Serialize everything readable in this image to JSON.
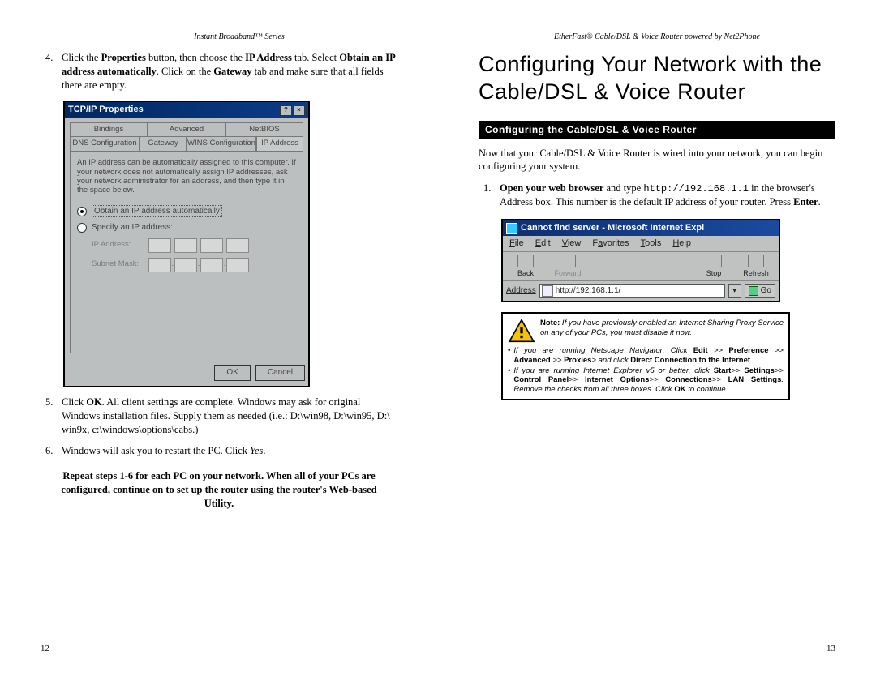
{
  "left": {
    "header": "Instant Broadband™ Series",
    "page_num": "12",
    "step4_a": "Click the ",
    "step4_b": "Properties",
    "step4_c": " button, then choose the ",
    "step4_d": "IP Address",
    "step4_e": " tab. Select ",
    "step4_f": "Obtain an IP address automatically",
    "step4_g": ". Click on the ",
    "step4_h": "Gateway",
    "step4_i": " tab and make sure that all fields there are empty.",
    "dlg": {
      "title": "TCP/IP Properties",
      "tabs_row1": [
        "Bindings",
        "Advanced",
        "NetBIOS"
      ],
      "tabs_row2": [
        "DNS Configuration",
        "Gateway",
        "WINS Configuration",
        "IP Address"
      ],
      "help": "An IP address can be automatically assigned to this computer. If your network does not automatically assign IP addresses, ask your network administrator for an address, and then type it in the space below.",
      "radio_obtain": "Obtain an IP address automatically",
      "radio_spec": "Specify an IP address:",
      "ip_lbl": "IP Address:",
      "sn_lbl": "Subnet Mask:",
      "ok": "OK",
      "cancel": "Cancel"
    },
    "step5_a": "Click ",
    "step5_b": "OK",
    "step5_c": ".  All client settings are complete.  Windows may ask for original Windows installation files. Supply them as needed (i.e.: D:\\win98, D:\\win95, D:\\ win9x, c:\\windows\\options\\cabs.)",
    "step6_a": "Windows will ask you to restart the PC. Click ",
    "step6_b": "Yes",
    "step6_c": ".",
    "repeat": "Repeat steps 1-6 for each PC on your network.  When all of your PCs are configured,  continue on to set up the router using the router's Web-based Utility."
  },
  "right": {
    "header": "EtherFast® Cable/DSL & Voice Router powered by Net2Phone",
    "page_num": "13",
    "big_heading": "Configuring Your Network with the Cable/DSL & Voice Router",
    "blackbar": "Configuring the Cable/DSL & Voice Router",
    "intro": "Now that your Cable/DSL & Voice Router is wired into your network, you can begin configuring your system.",
    "s1_a": "Open your web browser",
    "s1_b": " and type ",
    "s1_code": "http://192.168.1.1",
    "s1_c": " in the browser's Address box. This number is the default IP address of your router. Press ",
    "s1_d": "Enter",
    "s1_e": ".",
    "ie": {
      "title": "Cannot find server - Microsoft Internet Expl",
      "menu": [
        "File",
        "Edit",
        "View",
        "Favorites",
        "Tools",
        "Help"
      ],
      "tb": {
        "back": "Back",
        "forward": "Forward",
        "stop": "Stop",
        "refresh": "Refresh"
      },
      "addr_lbl": "Address",
      "url": "http://192.168.1.1/",
      "go": "Go"
    },
    "note": {
      "top_a": "Note:",
      "top_b": " If you have previously enabled an Internet Sharing Proxy Service on any of your PCs, you must disable it now.",
      "li1_a": "If you are running Netscape Navigator: Click ",
      "li1_b1": "Edit",
      "li1_c": " >> ",
      "li1_b2": "Preference",
      "li1_d": " >> ",
      "li1_b3": "Advanced",
      "li1_e": " >> ",
      "li1_b4": "Proxies",
      "li1_f": "> and click ",
      "li1_b5": "Direct Connection to the Internet",
      "li1_g": ".",
      "li2_a": "If you are running Internet Explorer v5 or better, click ",
      "li2_b1": "Start",
      "li2_c": ">> ",
      "li2_b2": "Settings",
      "li2_d": ">> ",
      "li2_b3": "Control Panel",
      "li2_e": ">> ",
      "li2_b4": "Internet Options",
      "li2_f": ">> ",
      "li2_b5": "Connections",
      "li2_g": ">> ",
      "li2_b6": "LAN Settings",
      "li2_h": ". Remove the checks from  all three boxes. Click ",
      "li2_b7": "OK",
      "li2_i": " to continue."
    }
  }
}
